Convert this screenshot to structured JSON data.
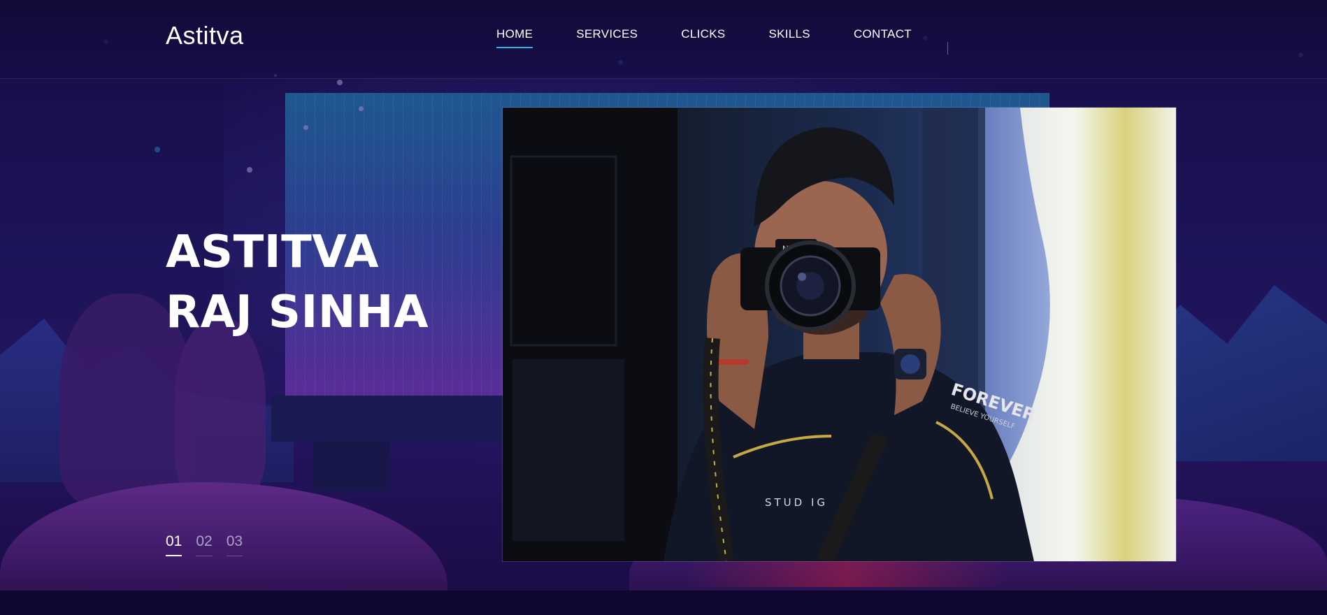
{
  "header": {
    "brand": "Astitva",
    "nav": [
      {
        "label": "HOME",
        "active": true
      },
      {
        "label": "SERVICES",
        "active": false
      },
      {
        "label": "CLICKS",
        "active": false
      },
      {
        "label": "SKILLS",
        "active": false
      },
      {
        "label": "CONTACT",
        "active": false
      }
    ]
  },
  "hero": {
    "title_line1": "ASTITVA",
    "title_line2": "RAJ SINHA",
    "photo": {
      "subject": "photographer holding Nikon camera",
      "camera_brand": "Nikon",
      "shirt_text": "FOREVER",
      "shirt_subtext": "BELIEVE YOURSELF"
    },
    "pager": [
      {
        "label": "01",
        "active": true
      },
      {
        "label": "02",
        "active": false
      },
      {
        "label": "03",
        "active": false
      }
    ]
  },
  "colors": {
    "background": "#1c1458",
    "accent": "#29b6e6",
    "text": "#ffffff",
    "muted": "#a8a4c9"
  }
}
